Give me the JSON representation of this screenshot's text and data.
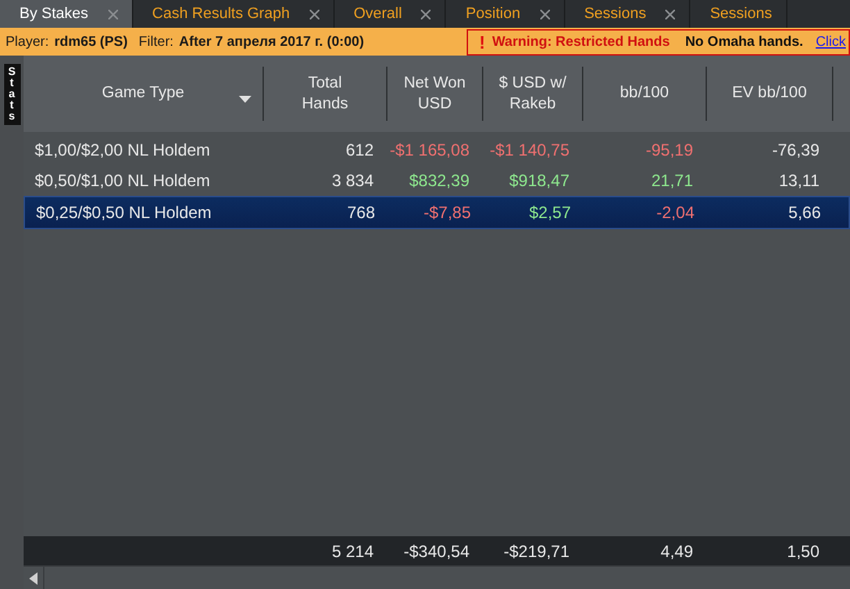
{
  "tabs": [
    {
      "label": "By Stakes",
      "selected": true
    },
    {
      "label": "Cash Results Graph",
      "selected": false
    },
    {
      "label": "Overall",
      "selected": false
    },
    {
      "label": "Position",
      "selected": false
    },
    {
      "label": "Sessions",
      "selected": false
    },
    {
      "label": "Sessions",
      "selected": false
    }
  ],
  "filter_bar": {
    "player_label": "Player:",
    "player": "rdm65 (PS)",
    "filter_label": "Filter:",
    "filter": "After 7 апреля 2017 г. (0:00)",
    "warning_icon": "!",
    "warning": "Warning: Restricted Hands",
    "note": "No Omaha hands.",
    "link": "Click"
  },
  "side_tab": "Stats",
  "table": {
    "columns": [
      "Game Type",
      "Total Hands",
      "Net Won USD",
      "$ USD w/ Rakeb",
      "bb/100",
      "EV bb/100"
    ],
    "rows": [
      {
        "selected": false,
        "cells": [
          {
            "text": "$1,00/$2,00 NL Holdem"
          },
          {
            "text": "612"
          },
          {
            "text": "-$1 165,08",
            "color": "#f07070"
          },
          {
            "text": "-$1 140,75",
            "color": "#f07070"
          },
          {
            "text": "-95,19",
            "color": "#f07070"
          },
          {
            "text": "-76,39"
          }
        ]
      },
      {
        "selected": false,
        "cells": [
          {
            "text": "$0,50/$1,00 NL Holdem"
          },
          {
            "text": "3 834"
          },
          {
            "text": "$832,39",
            "color": "#8ee88e"
          },
          {
            "text": "$918,47",
            "color": "#8ee88e"
          },
          {
            "text": "21,71",
            "color": "#8ee88e"
          },
          {
            "text": "13,11"
          }
        ]
      },
      {
        "selected": true,
        "cells": [
          {
            "text": "$0,25/$0,50 NL Holdem"
          },
          {
            "text": "768"
          },
          {
            "text": "-$7,85",
            "color": "#f07070"
          },
          {
            "text": "$2,57",
            "color": "#8ee88e"
          },
          {
            "text": "-2,04",
            "color": "#f07070"
          },
          {
            "text": "5,66"
          }
        ]
      }
    ],
    "totals": [
      "5 214",
      "-$340,54",
      "-$219,71",
      "4,49",
      "1,50"
    ]
  }
}
